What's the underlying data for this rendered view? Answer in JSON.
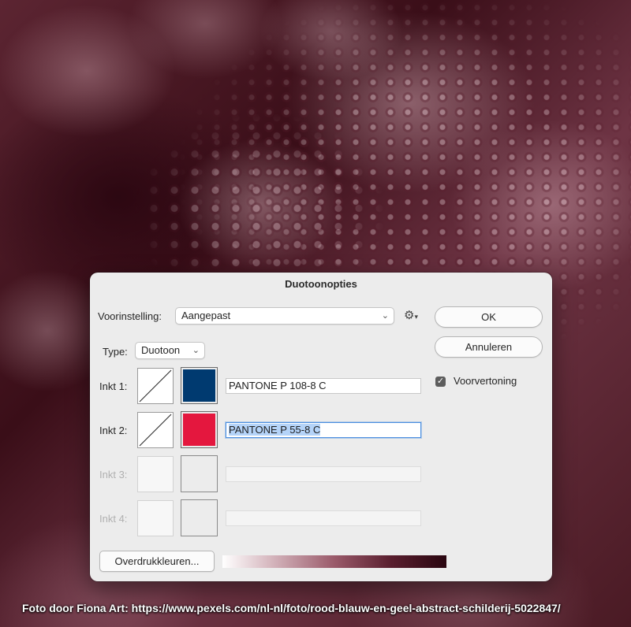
{
  "dialog": {
    "title": "Duotoonopties",
    "preset_label": "Voorinstelling:",
    "preset_value": "Aangepast",
    "gear_icon": "gear-menu-icon",
    "type_label": "Type:",
    "type_value": "Duotoon",
    "ok_label": "OK",
    "cancel_label": "Annuleren",
    "preview_label": "Voorvertoning",
    "preview_checked": true,
    "inks": [
      {
        "label": "Inkt 1:",
        "name": "PANTONE P 108-8 C",
        "color": "#003a70",
        "enabled": true,
        "focused": false
      },
      {
        "label": "Inkt 2:",
        "name": "PANTONE P 55-8 C",
        "color": "#e4173e",
        "enabled": true,
        "focused": true
      },
      {
        "label": "Inkt 3:",
        "name": "",
        "color": "",
        "enabled": false,
        "focused": false
      },
      {
        "label": "Inkt 4:",
        "name": "",
        "color": "",
        "enabled": false,
        "focused": false
      }
    ],
    "overprint_label": "Overdrukkleuren..."
  },
  "credit": "Foto door Fiona Art: https://www.pexels.com/nl-nl/foto/rood-blauw-en-geel-abstract-schilderij-5022847/"
}
